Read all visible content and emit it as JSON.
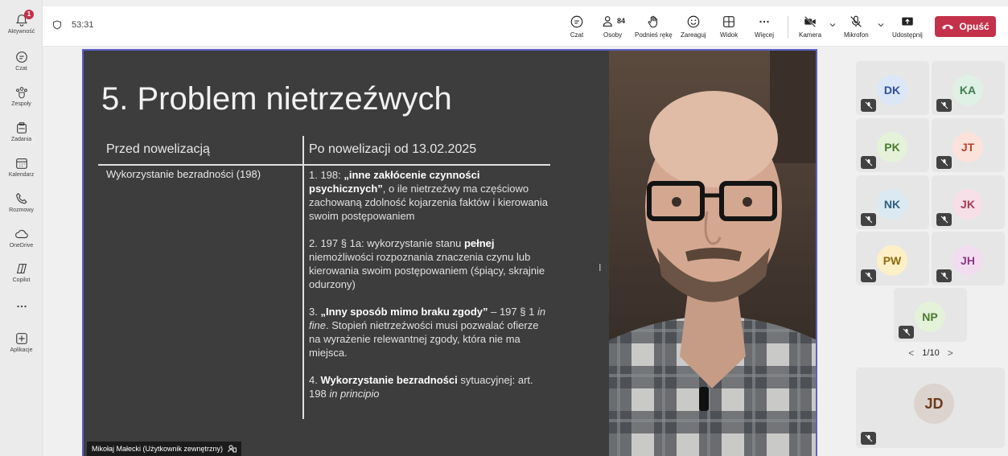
{
  "rail": [
    {
      "label": "Aktywność",
      "icon": "bell-icon",
      "badge": "1"
    },
    {
      "label": "Czat",
      "icon": "chat-icon"
    },
    {
      "label": "Zespoły",
      "icon": "teams-icon"
    },
    {
      "label": "Zadania",
      "icon": "tasks-icon"
    },
    {
      "label": "Kalendarz",
      "icon": "calendar-icon"
    },
    {
      "label": "Rozmowy",
      "icon": "phone-icon"
    },
    {
      "label": "OneDrive",
      "icon": "cloud-icon"
    },
    {
      "label": "Copilot",
      "icon": "copilot-icon"
    },
    {
      "label": "",
      "icon": "more-icon"
    },
    {
      "label": "Aplikacje",
      "icon": "add-app-icon"
    }
  ],
  "meeting": {
    "timer": "53:31",
    "people_count": "84"
  },
  "toolbar": {
    "chat": "Czat",
    "people": "Osoby",
    "raise_hand": "Podnieś rękę",
    "react": "Zareaguj",
    "view": "Widok",
    "more": "Więcej",
    "camera": "Kamera",
    "mic": "Mikrofon",
    "share": "Udostępnij",
    "leave": "Opuść"
  },
  "slide": {
    "title": "5. Problem nietrzeźwych",
    "col_before": "Przed nowelizacją",
    "col_after": "Po nowelizacji od 13.02.2025",
    "row_left": "Wykorzystanie bezradności (198)",
    "item1": {
      "a": "1. 198: ",
      "b": "„inne zakłócenie czynności psychicznych”",
      "c": ", o ile nietrzeźwy ma częściowo zachowaną zdolność kojarzenia faktów i kierowania swoim postępowaniem"
    },
    "item2": {
      "a": "2. 197 § 1a: wykorzystanie stanu ",
      "b": "pełnej",
      "c": " niemożliwości rozpoznania znaczenia czynu lub kierowania swoim postępowaniem (śpiący, skrajnie odurzony)"
    },
    "item3": {
      "a": "3. ",
      "b": "„Inny sposób mimo braku zgody”",
      "c": " – 197 § 1 ",
      "d": "in fine",
      "e": ". Stopień nietrzeźwości musi pozwalać ofierze na wyrażenie relewantnej zgody, która nie ma miejsca."
    },
    "item4": {
      "a": "4. ",
      "b": "Wykorzystanie bezradności",
      "c": " sytuacyjnej: art. 198 ",
      "d": "in principio"
    },
    "cursor_glyph": "I"
  },
  "presenter": {
    "name": "Mikołaj Małecki (Użytkownik zewnętrzny)"
  },
  "participants": [
    {
      "initials": "DK",
      "bg": "#dbe6f7",
      "fg": "#2d4f99"
    },
    {
      "initials": "KA",
      "bg": "#dff1e4",
      "fg": "#3e7d4f"
    },
    {
      "initials": "PK",
      "bg": "#e3f2d9",
      "fg": "#4d7a2f"
    },
    {
      "initials": "JT",
      "bg": "#fbe3db",
      "fg": "#b2452b"
    },
    {
      "initials": "NK",
      "bg": "#dbeaf2",
      "fg": "#2f5f7d"
    },
    {
      "initials": "JK",
      "bg": "#f6dfe6",
      "fg": "#a23b57"
    },
    {
      "initials": "PW",
      "bg": "#fdf0c6",
      "fg": "#8a6a0f"
    },
    {
      "initials": "JH",
      "bg": "#f2ddf0",
      "fg": "#8a3a85"
    },
    {
      "initials": "NP",
      "bg": "#e3f2d9",
      "fg": "#4d7a2f"
    }
  ],
  "pager": {
    "label": "1/10",
    "prev": "<",
    "next": ">"
  },
  "self_tile": {
    "initials": "JD"
  },
  "colors": {
    "accent": "#5b5fc7",
    "leave": "#c4314b"
  }
}
